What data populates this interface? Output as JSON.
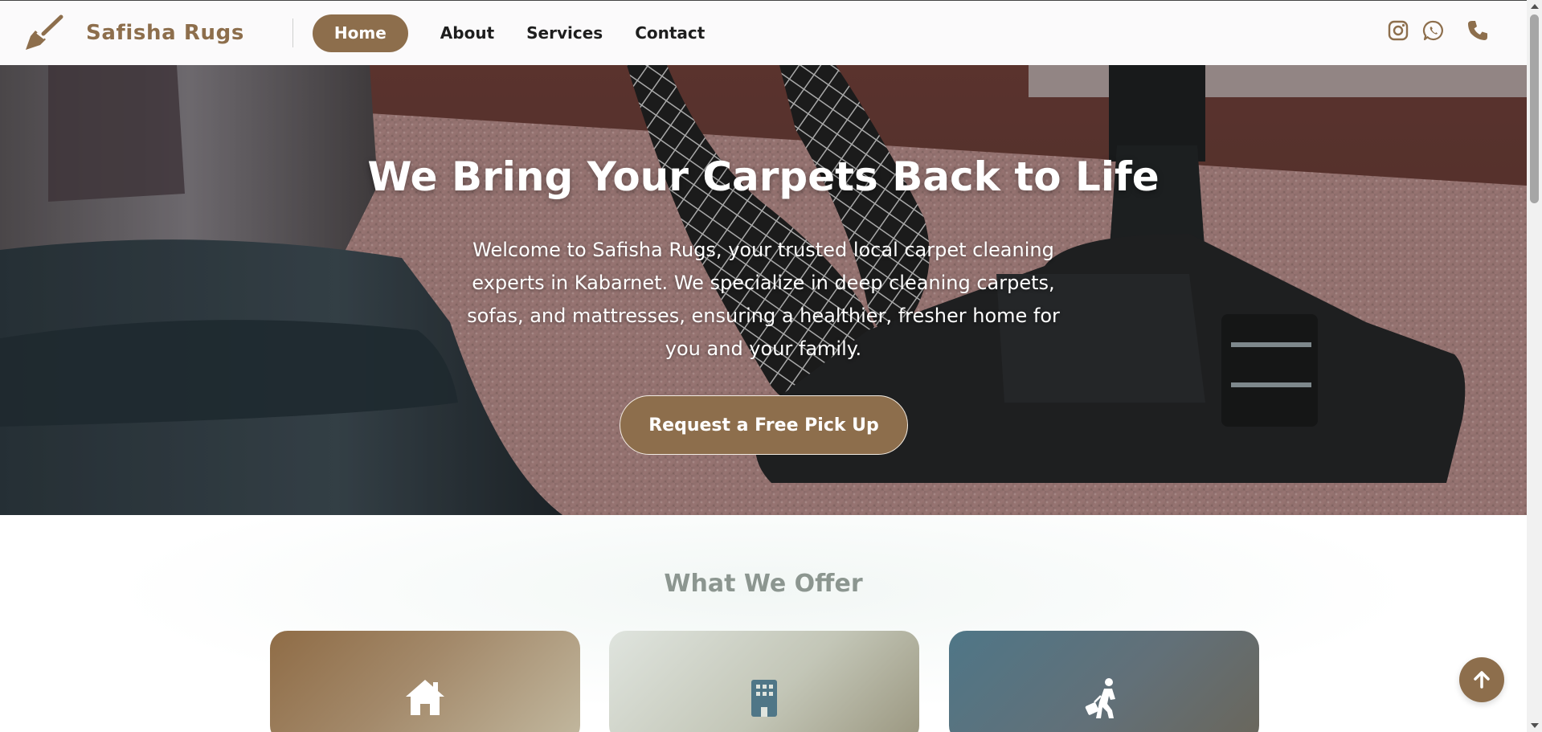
{
  "brand": {
    "name": "Safisha Rugs",
    "color": "#8d6e4c"
  },
  "nav": {
    "links": [
      {
        "label": "Home",
        "active": true
      },
      {
        "label": "About",
        "active": false
      },
      {
        "label": "Services",
        "active": false
      },
      {
        "label": "Contact",
        "active": false
      }
    ],
    "social_icons": [
      "instagram-icon",
      "whatsapp-icon",
      "phone-icon"
    ]
  },
  "hero": {
    "title": "We Bring Your Carpets Back to Life",
    "text": "Welcome to Safisha Rugs, your trusted local carpet cleaning experts in Kabarnet. We specialize in deep cleaning carpets, sofas, and mattresses, ensuring a healthier, fresher home for you and your family.",
    "cta_label": "Request a Free Pick Up"
  },
  "offers": {
    "title": "What We Offer",
    "cards": [
      {
        "icon": "home-icon"
      },
      {
        "icon": "building-icon"
      },
      {
        "icon": "traveler-luggage-icon"
      }
    ]
  },
  "floating": {
    "scroll_top_icon": "arrow-up-icon"
  },
  "colors": {
    "accent": "#8d6e4c",
    "heading_muted": "#8c9690"
  }
}
